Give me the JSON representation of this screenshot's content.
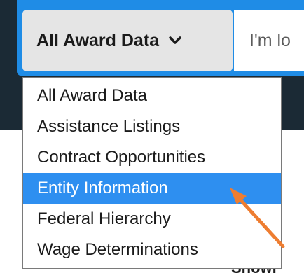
{
  "header": {
    "category_selected": "All Award Data",
    "search_placeholder": "I'm lo"
  },
  "dropdown": {
    "options": [
      "All Award Data",
      "Assistance Listings",
      "Contract Opportunities",
      "Entity Information",
      "Federal Hierarchy",
      "Wage Determinations"
    ],
    "highlighted_index": 3
  },
  "background_text": "Showi",
  "colors": {
    "header_dark": "#1b2a35",
    "accent_blue": "#1f8ce6",
    "highlight_blue": "#2e8ff0",
    "annotation_arrow": "#ee7d31"
  },
  "icons": {
    "category_toggle": "chevron-down-icon",
    "annotation": "arrow-annotation-icon"
  }
}
